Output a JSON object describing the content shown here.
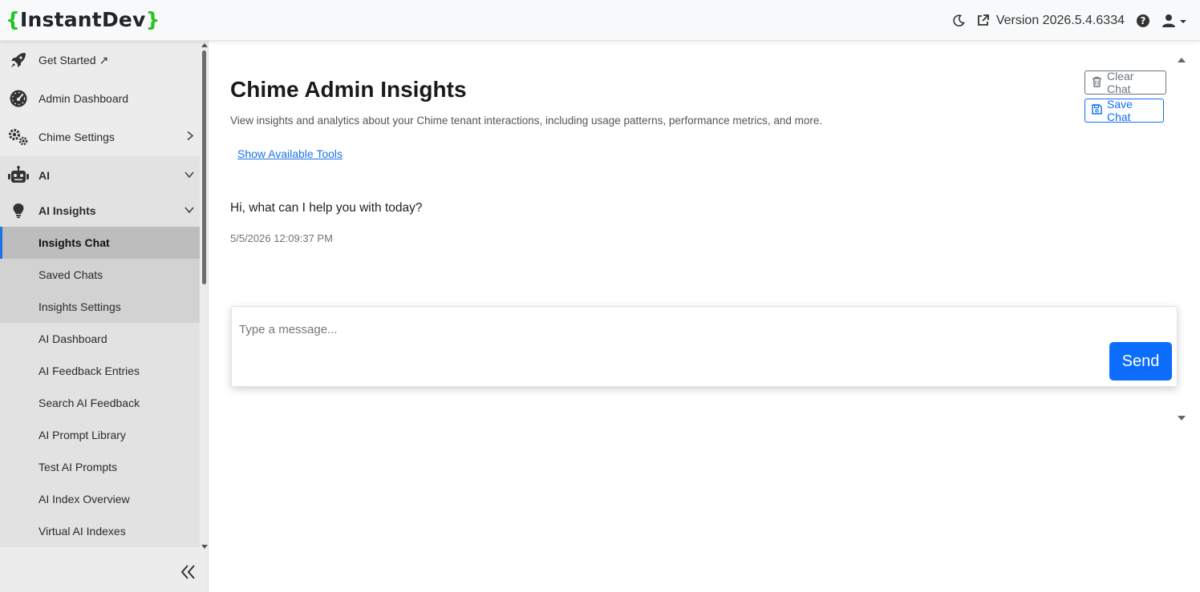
{
  "brand": {
    "open_brace": "{",
    "name": "InstantDev",
    "close_brace": "}",
    "brace_color": "#22c51f"
  },
  "header": {
    "version_text": "Version 2026.5.4.6334"
  },
  "sidebar": {
    "items": [
      {
        "label": "Get Started ↗",
        "icon": "rocket-icon"
      },
      {
        "label": "Admin Dashboard",
        "icon": "gauge-icon"
      },
      {
        "label": "Chime Settings",
        "icon": "gears-icon"
      },
      {
        "label": "AI",
        "icon": "robot-icon"
      },
      {
        "label": "AI Insights",
        "icon": "lightbulb-icon"
      }
    ],
    "insights_children": [
      "Insights Chat",
      "Saved Chats",
      "Insights Settings"
    ],
    "ai_children": [
      "AI Dashboard",
      "AI Feedback Entries",
      "Search AI Feedback",
      "AI Prompt Library",
      "Test AI Prompts",
      "AI Index Overview",
      "Virtual AI Indexes"
    ],
    "active_item": "Insights Chat",
    "accent_color": "#1a73e8"
  },
  "page": {
    "title": "Chime Admin Insights",
    "description": "View insights and analytics about your Chime tenant interactions, including usage patterns, performance metrics, and more.",
    "tools_link": "Show Available Tools",
    "clear_label": "Clear Chat",
    "save_label": "Save Chat"
  },
  "chat": {
    "greeting": "Hi, what can I help you with today?",
    "timestamp": "5/5/2026 12:09:37 PM",
    "placeholder": "Type a message...",
    "send_label": "Send",
    "send_color": "#0d6efd"
  }
}
